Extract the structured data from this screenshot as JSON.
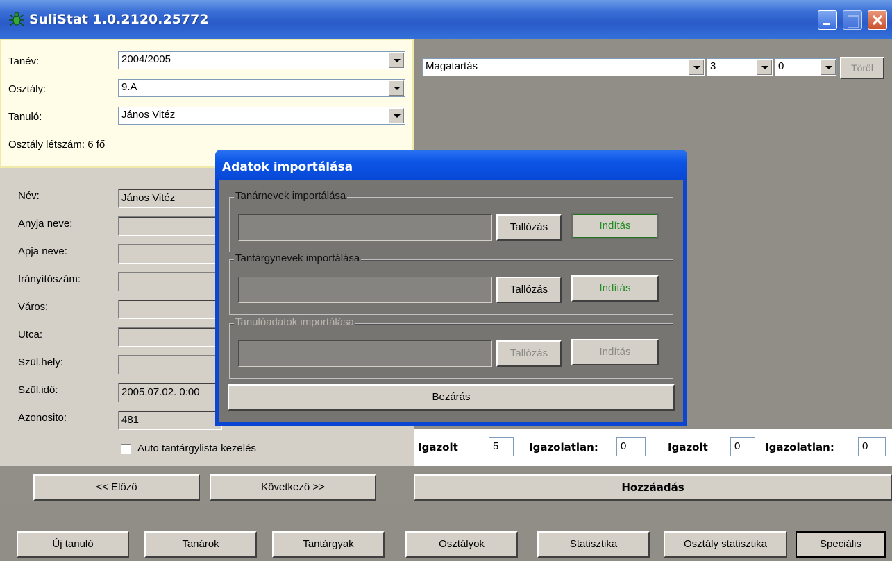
{
  "window": {
    "title": "SuliStat 1.0.2120.25772"
  },
  "filter": {
    "tanev_label": "Tanév:",
    "tanev_value": "2004/2005",
    "osztaly_label": "Osztály:",
    "osztaly_value": "9.A",
    "tanulo_label": "Tanuló:",
    "tanulo_value": "János Vitéz",
    "letszam_text": "Osztály létszám: 6 fő"
  },
  "student": {
    "fields": [
      {
        "label": "Név:",
        "value": "János Vitéz"
      },
      {
        "label": "Anyja neve:",
        "value": ""
      },
      {
        "label": "Apja neve:",
        "value": ""
      },
      {
        "label": "Irányítószám:",
        "value": ""
      },
      {
        "label": "Város:",
        "value": ""
      },
      {
        "label": "Utca:",
        "value": ""
      },
      {
        "label": "Szül.hely:",
        "value": ""
      },
      {
        "label": "Szül.idő:",
        "value": "2005.07.02. 0:00"
      },
      {
        "label": "Azonosito:",
        "value": "481"
      }
    ],
    "auto_label": "Auto tantárgylista kezelés"
  },
  "nav": {
    "prev": "<< Előző",
    "next": "Következő >>"
  },
  "grades": {
    "subject": "Magatartás",
    "grade": "3",
    "extra": "0",
    "delete": "Töröl"
  },
  "absence": {
    "igazolt1_label": "Igazolt",
    "igazolt1_value": "5",
    "igazolatlan1_label": "Igazolatlan:",
    "igazolatlan1_value": "0",
    "igazolt2_label": "Igazolt",
    "igazolt2_value": "0",
    "igazolatlan2_label": "Igazolatlan:",
    "igazolatlan2_value": "0",
    "add": "Hozzáadás"
  },
  "footer": {
    "buttons": [
      "Új tanuló",
      "Tanárok",
      "Tantárgyak",
      "Osztályok",
      "Statisztika",
      "Osztály statisztika",
      "Speciális"
    ]
  },
  "dialog": {
    "title": "Adatok importálása",
    "groups": [
      {
        "label": "Tanárnevek importálása",
        "browse": "Tallózás",
        "start": "Indítás"
      },
      {
        "label": "Tantárgynevek importálása",
        "browse": "Tallózás",
        "start": "Indítás"
      },
      {
        "label": "Tanulóadatok importálása",
        "browse": "Tallózás",
        "start": "Indítás"
      }
    ],
    "close": "Bezárás"
  }
}
